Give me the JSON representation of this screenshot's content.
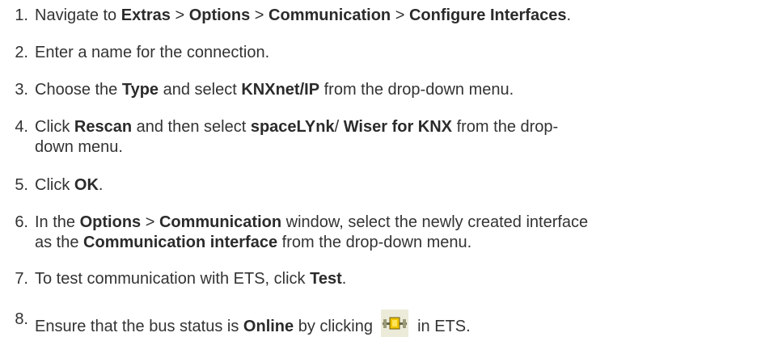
{
  "steps": [
    {
      "number": "1.",
      "parts": [
        {
          "t": "Navigate to ",
          "b": false
        },
        {
          "t": "Extras",
          "b": true
        },
        {
          "t": " > ",
          "b": false
        },
        {
          "t": "Options",
          "b": true
        },
        {
          "t": " > ",
          "b": false
        },
        {
          "t": "Communication",
          "b": true
        },
        {
          "t": " > ",
          "b": false
        },
        {
          "t": "Configure Interfaces",
          "b": true
        },
        {
          "t": ".",
          "b": false
        }
      ]
    },
    {
      "number": "2.",
      "parts": [
        {
          "t": "Enter a name for the connection.",
          "b": false
        }
      ]
    },
    {
      "number": "3.",
      "parts": [
        {
          "t": "Choose the ",
          "b": false
        },
        {
          "t": "Type",
          "b": true
        },
        {
          "t": " and select ",
          "b": false
        },
        {
          "t": "KNXnet/IP",
          "b": true
        },
        {
          "t": " from the drop-down menu.",
          "b": false
        }
      ]
    },
    {
      "number": "4.",
      "parts": [
        {
          "t": "Click ",
          "b": false
        },
        {
          "t": "Rescan",
          "b": true
        },
        {
          "t": " and then select ",
          "b": false
        },
        {
          "t": "spaceLYnk",
          "b": true
        },
        {
          "t": "/ ",
          "b": false
        },
        {
          "t": "Wiser for KNX",
          "b": true
        },
        {
          "t": "  from the drop-",
          "b": false
        },
        {
          "br": true
        },
        {
          "t": "down menu.",
          "b": false
        }
      ]
    },
    {
      "number": "5.",
      "parts": [
        {
          "t": "Click ",
          "b": false
        },
        {
          "t": "OK",
          "b": true
        },
        {
          "t": ".",
          "b": false
        }
      ]
    },
    {
      "number": "6.",
      "parts": [
        {
          "t": "In the ",
          "b": false
        },
        {
          "t": "Options",
          "b": true
        },
        {
          "t": " > ",
          "b": false
        },
        {
          "t": "Communication",
          "b": true
        },
        {
          "t": " window, select the newly created interface",
          "b": false
        },
        {
          "br": true
        },
        {
          "t": "as the ",
          "b": false
        },
        {
          "t": "Communication interface",
          "b": true
        },
        {
          "t": " from the drop-down menu.",
          "b": false
        }
      ]
    },
    {
      "number": "7.",
      "parts": [
        {
          "t": "To test communication with ETS, click ",
          "b": false
        },
        {
          "t": "Test",
          "b": true
        },
        {
          "t": ".",
          "b": false
        }
      ]
    },
    {
      "number": "8.",
      "parts": [
        {
          "t": "Ensure that the bus status is ",
          "b": false
        },
        {
          "t": "Online",
          "b": true
        },
        {
          "t": " by clicking ",
          "b": false
        },
        {
          "icon": "bus-online-toolbar-icon"
        },
        {
          "t": " in ETS.",
          "b": false
        }
      ]
    }
  ]
}
